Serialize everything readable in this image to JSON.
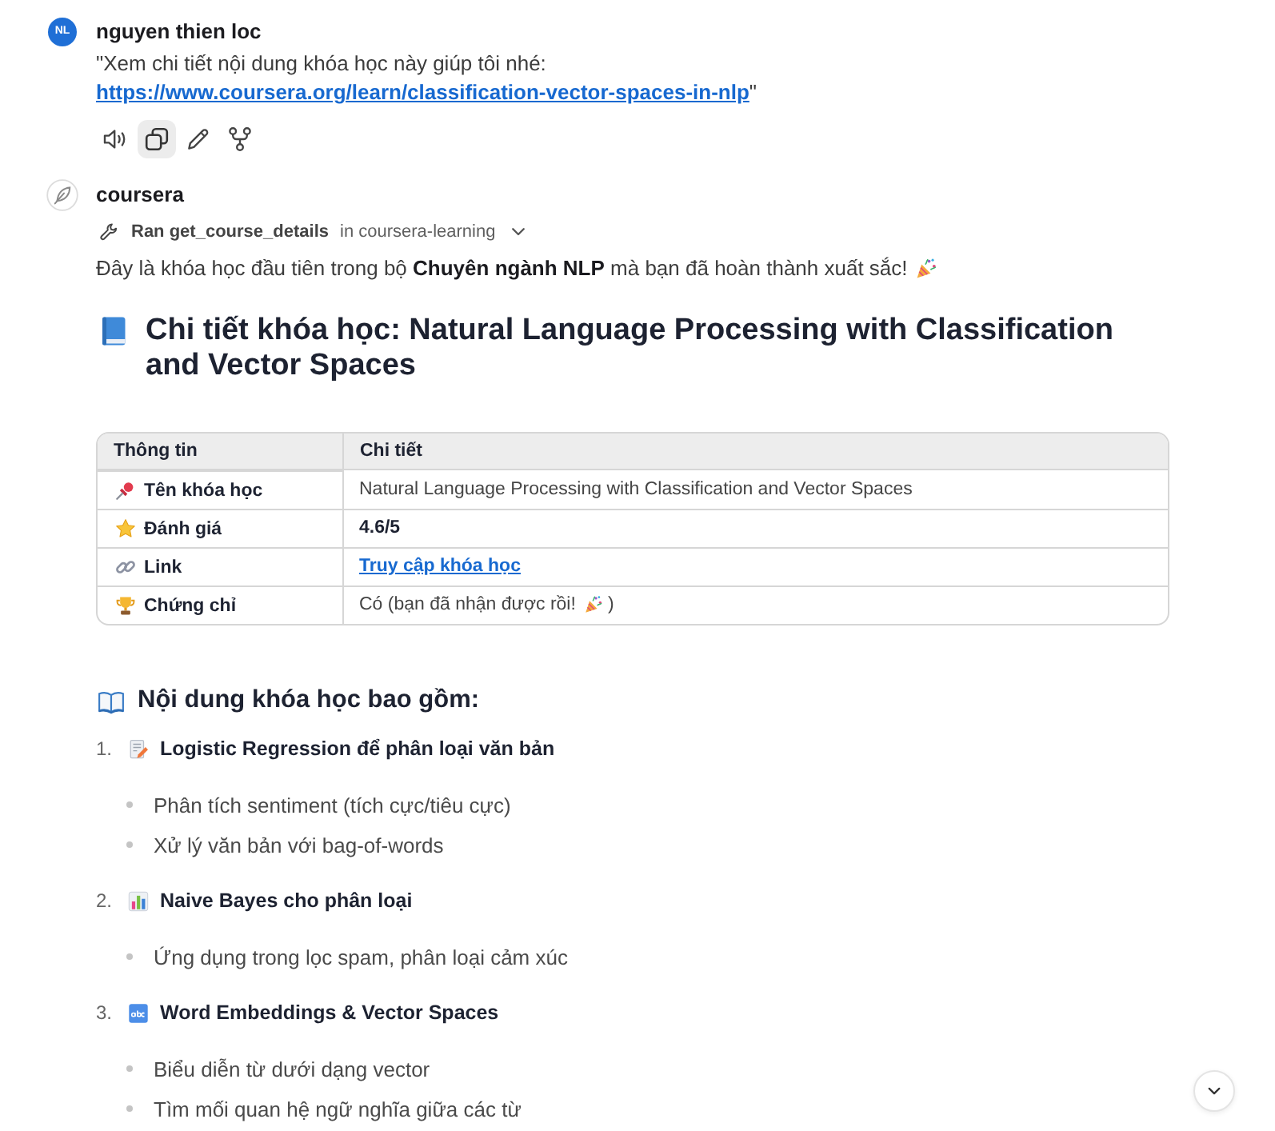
{
  "user_message": {
    "avatar": "NL",
    "author": "nguyen thien loc",
    "text_before": "\"Xem chi tiết nội dung khóa học này giúp tôi nhé: ",
    "link": "https://www.coursera.org/learn/classification-vector-spaces-in-nlp",
    "text_after": "\"",
    "actions": [
      {
        "selected": false
      },
      {
        "selected": true
      },
      {
        "selected": false
      },
      {
        "selected": false
      }
    ]
  },
  "assistant_message": {
    "author": "coursera",
    "tool_call": {
      "label": "Ran get_course_details",
      "source": "in coursera-learning",
      "expanded": false
    },
    "intro": "Đây là khóa học đầu tiên trong bộ **Chuyên ngành NLP** mà bạn đã hoàn thành xuất sắc!",
    "heading": "Chi tiết khóa học: Natural Language Processing with Classification and Vector Spaces",
    "table": {
      "columns": [
        "Thông tin",
        "Chi tiết"
      ],
      "rows": [
        {
          "label": "Tên khóa học",
          "kind": "plain",
          "value": "Natural Language Processing with Classification and Vector Spaces"
        },
        {
          "label": "Đánh giá",
          "kind": "bold",
          "value": "4.6/5"
        },
        {
          "label": "Link",
          "kind": "link",
          "value": "Truy cập khóa học"
        },
        {
          "label": "Chứng chỉ",
          "kind": "celebration",
          "value": "Có (bạn đã nhận được rồi!",
          "value_end": ")"
        }
      ]
    },
    "section_heading": "Nội dung khóa học bao gồm:",
    "topics": [
      {
        "number": "1.",
        "title": "Logistic Regression để phân loại văn bản",
        "points": [
          "Phân tích sentiment (tích cực/tiêu cực)",
          "Xử lý văn bản với bag-of-words"
        ]
      },
      {
        "number": "2.",
        "title": "Naive Bayes cho phân loại",
        "points": [
          "Ứng dụng trong lọc spam, phân loại cảm xúc"
        ]
      },
      {
        "number": "3.",
        "title": "Word Embeddings & Vector Spaces",
        "points": [
          "Biểu diễn từ dưới dạng vector",
          "Tìm mối quan hệ ngữ nghĩa giữa các từ"
        ]
      }
    ]
  }
}
